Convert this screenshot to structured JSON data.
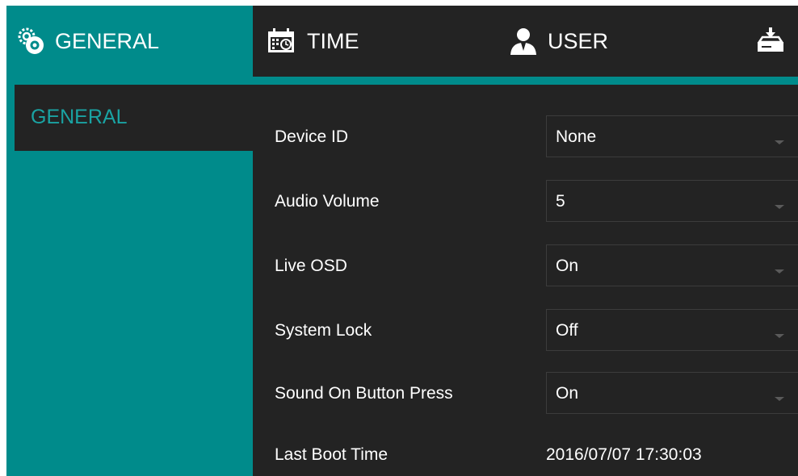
{
  "tabs": [
    {
      "label": "GENERAL",
      "icon": "gears-icon",
      "active": true
    },
    {
      "label": "TIME",
      "icon": "calendar-clock-icon",
      "active": false
    },
    {
      "label": "USER",
      "icon": "user-icon",
      "active": false
    },
    {
      "label": "",
      "icon": "download-tray-icon",
      "active": false
    }
  ],
  "sidebar": {
    "items": [
      {
        "label": "GENERAL",
        "active": true
      }
    ]
  },
  "settings": [
    {
      "label": "Device ID",
      "value": "None",
      "type": "select"
    },
    {
      "label": "Audio Volume",
      "value": "5",
      "type": "select"
    },
    {
      "label": "Live OSD",
      "value": "On",
      "type": "select"
    },
    {
      "label": "System Lock",
      "value": "Off",
      "type": "select"
    },
    {
      "label": "Sound On Button Press",
      "value": "On",
      "type": "select"
    },
    {
      "label": "Last Boot Time",
      "value": "2016/07/07 17:30:03",
      "type": "static"
    }
  ],
  "colors": {
    "accent": "#008b8b",
    "background": "#232323",
    "sidebar_text_active": "#1aa3a3",
    "text": "#ffffff"
  }
}
